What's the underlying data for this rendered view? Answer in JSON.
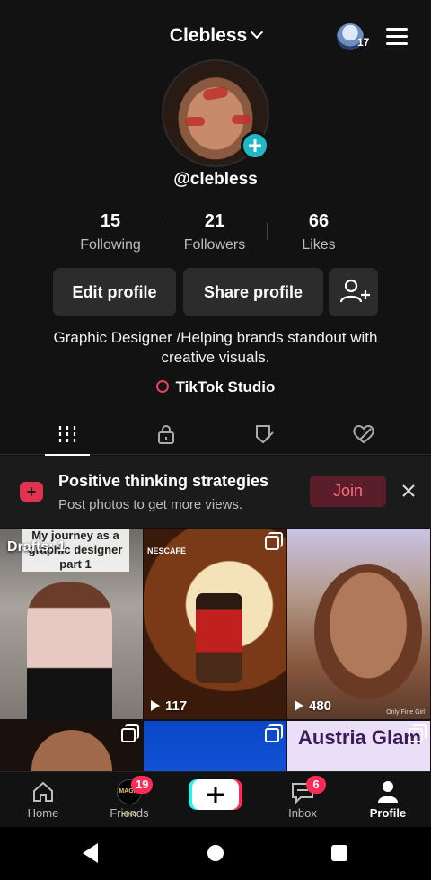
{
  "header": {
    "username": "Clebless",
    "notification_count": "17"
  },
  "profile": {
    "handle": "@clebless",
    "stats": [
      {
        "value": "15",
        "label": "Following"
      },
      {
        "value": "21",
        "label": "Followers"
      },
      {
        "value": "66",
        "label": "Likes"
      }
    ],
    "edit_label": "Edit profile",
    "share_label": "Share profile",
    "bio": "Graphic Designer /Helping brands standout with creative visuals.",
    "studio_label": "TikTok Studio"
  },
  "tabs": [
    "videos-grid-icon",
    "lock-icon",
    "tag-eye-icon",
    "liked-heart-icon"
  ],
  "banner": {
    "title": "Positive thinking strategies",
    "subtitle": "Post photos to get more views.",
    "join_label": "Join"
  },
  "grid": [
    {
      "overlay": "Drafts: 1",
      "caption": "My journey as a graphic designer part 1"
    },
    {
      "views": "117",
      "brand": "NESCAFÉ"
    },
    {
      "views": "480",
      "tag": "Only Fine Girl"
    },
    {},
    {},
    {
      "text": "Austria Glam"
    }
  ],
  "nav": {
    "home": "Home",
    "friends": "Friends",
    "friends_logo": "MAGIC KING",
    "friends_badge": "19",
    "inbox": "Inbox",
    "inbox_badge": "6",
    "profile": "Profile"
  },
  "colors": {
    "accent": "#fe2c55",
    "teal": "#20b7c6",
    "background": "#121212",
    "button": "#2c2c2c"
  }
}
